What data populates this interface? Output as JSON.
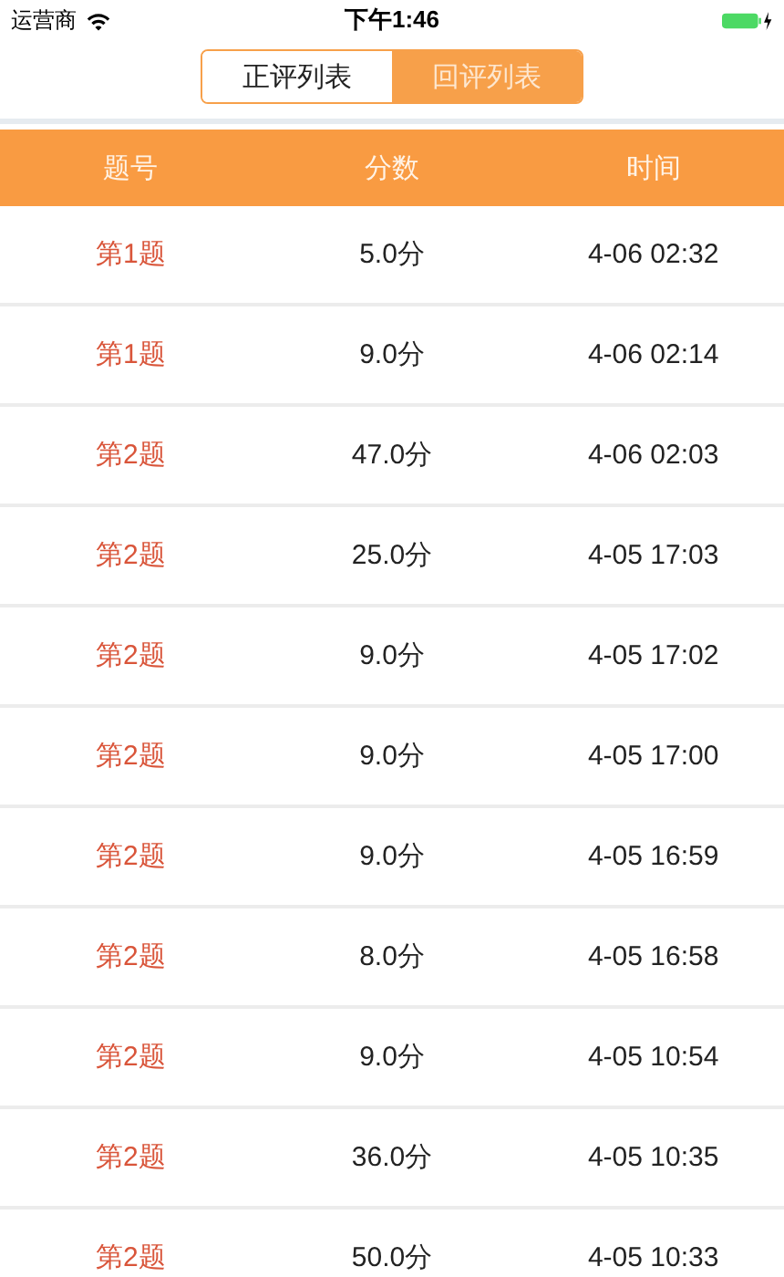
{
  "status_bar": {
    "carrier": "运营商",
    "time": "下午1:46"
  },
  "tabs": [
    {
      "label": "正评列表",
      "selected": false
    },
    {
      "label": "回评列表",
      "selected": true
    }
  ],
  "table": {
    "columns": [
      "题号",
      "分数",
      "时间"
    ],
    "rows": [
      [
        "第1题",
        "5.0分",
        "4-06 02:32"
      ],
      [
        "第1题",
        "9.0分",
        "4-06 02:14"
      ],
      [
        "第2题",
        "47.0分",
        "4-06 02:03"
      ],
      [
        "第2题",
        "25.0分",
        "4-05 17:03"
      ],
      [
        "第2题",
        "9.0分",
        "4-05 17:02"
      ],
      [
        "第2题",
        "9.0分",
        "4-05 17:00"
      ],
      [
        "第2题",
        "9.0分",
        "4-05 16:59"
      ],
      [
        "第2题",
        "8.0分",
        "4-05 16:58"
      ],
      [
        "第2题",
        "9.0分",
        "4-05 10:54"
      ],
      [
        "第2题",
        "36.0分",
        "4-05 10:35"
      ],
      [
        "第2题",
        "50.0分",
        "4-05 10:33"
      ]
    ]
  }
}
